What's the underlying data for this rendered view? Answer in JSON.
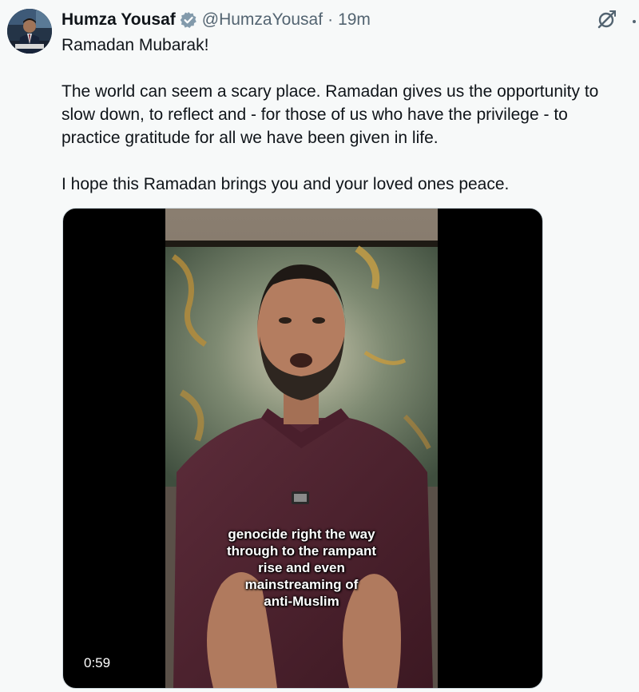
{
  "author": {
    "display_name": "Humza Yousaf",
    "handle": "@HumzaYousaf",
    "separator": "·",
    "time": "19m",
    "verified_color": "#829aab"
  },
  "tweet": {
    "lines": [
      "Ramadan Mubarak!",
      "The world can seem a scary place. Ramadan gives us the opportunity to slow down, to reflect and - for those of us who have the privilege - to practice gratitude for all we have been given in life.",
      "I hope this Ramadan brings you and your loved ones peace."
    ]
  },
  "media": {
    "type": "video",
    "caption_lines": [
      "genocide right the way",
      "through to the rampant",
      "rise and even",
      "mainstreaming of",
      "anti-Muslim"
    ],
    "duration": "0:59"
  },
  "icons": {
    "verified": "verified-badge-icon",
    "grok": "grok-icon",
    "more": "more-options-icon"
  }
}
